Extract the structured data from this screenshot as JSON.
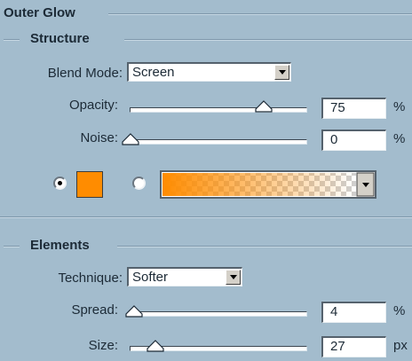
{
  "outer_glow_title": "Outer Glow",
  "structure": {
    "title": "Structure",
    "blend_mode": {
      "label": "Blend Mode:",
      "value": "Screen"
    },
    "opacity": {
      "label": "Opacity:",
      "value": "75",
      "unit": "%",
      "level": 0.75
    },
    "noise": {
      "label": "Noise:",
      "value": "0",
      "unit": "%",
      "level": 0
    },
    "color_radio_selected": "solid-color",
    "glow_color": "#ff8c00"
  },
  "elements": {
    "title": "Elements",
    "technique": {
      "label": "Technique:",
      "value": "Softer"
    },
    "spread": {
      "label": "Spread:",
      "value": "4",
      "unit": "%",
      "level": 0.04
    },
    "size": {
      "label": "Size:",
      "value": "27",
      "unit": "px"
    }
  }
}
